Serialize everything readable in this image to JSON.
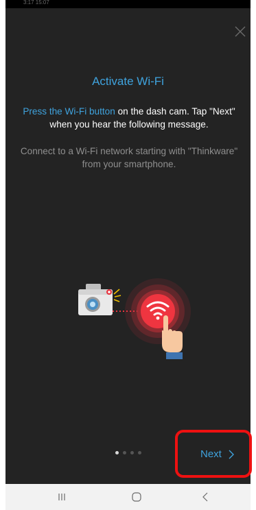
{
  "status_bar": {
    "time": "3:17 15:07"
  },
  "dialog": {
    "close_icon": "close-icon",
    "title": "Activate Wi-Fi",
    "instruction_highlight": "Press the Wi-Fi button",
    "instruction_rest": " on the dash cam. Tap \"Next\" when you hear the following message.",
    "hint": "Connect to a Wi-Fi network starting with \"Thinkware\" from your smartphone.",
    "illustration_icons": [
      "dash-cam-icon",
      "wifi-icon",
      "pointing-hand-icon"
    ]
  },
  "pager": {
    "total": 4,
    "active_index": 0
  },
  "next_button": {
    "label": "Next",
    "icon": "chevron-right-icon"
  },
  "nav_bar": {
    "items": [
      {
        "name": "recent-apps",
        "icon": "recent-apps-icon"
      },
      {
        "name": "home",
        "icon": "home-icon"
      },
      {
        "name": "back",
        "icon": "back-icon"
      }
    ]
  },
  "colors": {
    "accent": "#3fa3de",
    "background": "#232323",
    "highlight_box": "#ee1111",
    "wifi_button": "#e8343f"
  }
}
